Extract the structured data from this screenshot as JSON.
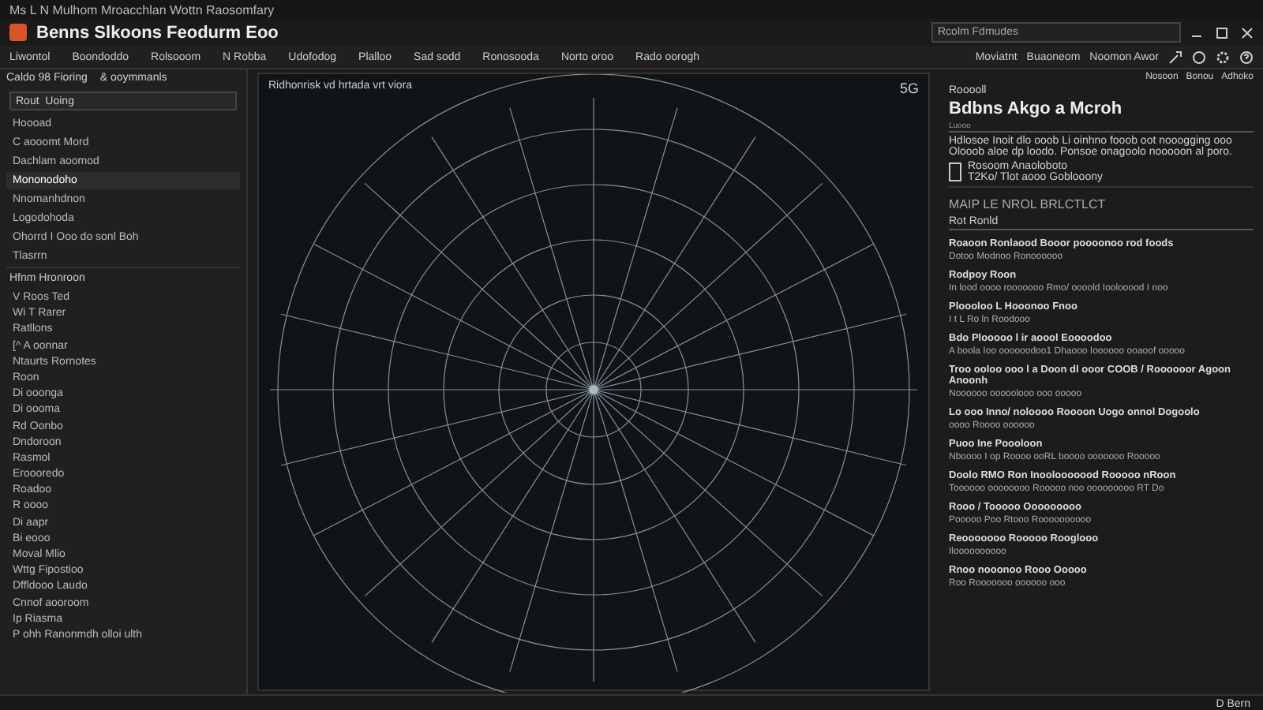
{
  "window": {
    "caption": "Ms L N Mulhom Mroacchlan  Wottn Raosomfary",
    "title": "Benns Slkoons  Feodurm Eoo"
  },
  "search": {
    "placeholder": "Rcolm Fdmudes"
  },
  "menu": [
    "Liwontol",
    "Boondoddo",
    "Rolsooom",
    "N Robba",
    "Udofodog",
    "Plalloo",
    "Sad sodd",
    "Ronosooda",
    "Norto oroo",
    "Rado oorogh"
  ],
  "toolbar": [
    "Moviatnt",
    "Buaoneom",
    "Noomon Awor"
  ],
  "sidebar": {
    "title": "Caldo 98 Fioring",
    "subtitle": "& ooymmanls",
    "search": "Rout  Uoing",
    "items": [
      {
        "label": "Hoooad",
        "selected": false
      },
      {
        "label": "C aooomt Mord",
        "selected": false
      },
      {
        "label": "Dachlam aoomod",
        "selected": false
      },
      {
        "label": "Mononodoho",
        "selected": true
      },
      {
        "label": "Nnomanhdnon",
        "selected": false
      },
      {
        "label": "Logodohoda",
        "selected": false
      },
      {
        "label": "Ohorrd I Ooo do sonl Boh",
        "selected": false
      },
      {
        "label": "Tlasrrn",
        "selected": false
      }
    ],
    "section": "Hfnm  Hronroon",
    "entries": [
      "V Roos Ted",
      "Wi T Rarer",
      "Ratllons",
      "[^ A oonnar",
      "Ntaurts Rornotes",
      "Roon",
      "Di ooonga",
      "Di oooma",
      "Rd Oonbo",
      "Dndoroon",
      "Rasmol",
      "Eroooredo",
      "Roadoo",
      "R oooo",
      "Di aapr",
      "Bi eooo",
      "Moval Mlio",
      "Wttg Fipostioo",
      "Dffldooo Laudo",
      "Cnnof aooroom",
      "Ip Riasma"
    ],
    "footer": "P ohh Ranonmdh olloi ulth"
  },
  "canvas": {
    "caption": "Ridhonrisk vd hrtada vrt viora",
    "badge": "5G"
  },
  "panel": {
    "links": [
      "Nosoon",
      "Bonou",
      "Adhoko"
    ],
    "kicker": "Rooooll",
    "title": "Bdbns Akgo a Mcroh",
    "subtitle": "Luooo",
    "description": "Hdlosoe Inoit dlo ooob Li oinhno fooob oot nooogging ooo Olooob aloe dp loodo. Ponsoe onagoolo nooooon al poro.",
    "file": {
      "name": "Rosoom  Anaoloboto",
      "meta": "T2Ko/ Tlot aooo Goblooony"
    },
    "section": "MAIP LE NROL BRLCTLCT",
    "select": "Rot Ronld",
    "entries": [
      {
        "title": "Roaoon Ronlaood Booor poooonoo rod foods",
        "body": "Dotoo Modnoo Ronoooooo"
      },
      {
        "title": "Rodpoy Roon",
        "body": "In lood oooo rooooooo Rmo/ oooold Ioolooood I noo"
      },
      {
        "title": "Ploooloo  L Hooonoo Fnoo",
        "body": "I t L Ro ln Roodooo"
      },
      {
        "title": "Bdo Plooooo l ir  aoool Eoooodoo",
        "body": "A boola Ioo oooooodoo1 Dhaooo Ioooooo ooaoof ooooo"
      },
      {
        "title": "Troo ooloo ooo l a Doon dl ooor COOB / Roooooor Agoon Anoonh",
        "body": "Noooooo ooooolooo ooo ooooo"
      },
      {
        "title": "Lo ooo Inno/ noloooo Roooon Uogo onnol Dogoolo",
        "body": "oooo Roooo oooooo"
      },
      {
        "title": "Puoo Ine  Poooloon",
        "body": "Nboooo I op Roooo ooRL  boooo ooooooo Rooooo"
      },
      {
        "title": "Doolo RMO Ron Inoolooooood Rooooo nRoon",
        "body": "Toooooo oooooooo Rooooo noo ooooooooo RT Do"
      },
      {
        "title": "Rooo / Tooooo Ooooooooo",
        "body": "Pooooo Poo Rtooo Roooooooooo"
      },
      {
        "title": "Reooooooo Rooooo Rooglooo",
        "body": "Iloooooooooo"
      },
      {
        "title": "Rnoo nooonoo Rooo Ooooo",
        "body": "Roo Rooooooo oooooo ooo"
      }
    ]
  },
  "status": "D Bern"
}
